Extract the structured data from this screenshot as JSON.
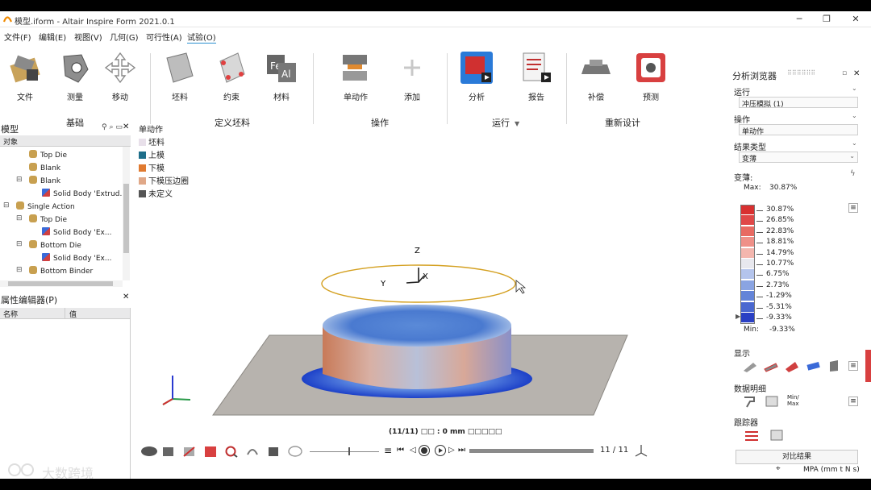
{
  "window": {
    "title": "模型.iform - Altair Inspire Form 2021.0.1",
    "minimize": "─",
    "maximize": "❐",
    "close": "✕"
  },
  "menu": [
    "文件(F)",
    "编辑(E)",
    "视图(V)",
    "几何(G)",
    "可行性(A)",
    "试验(O)"
  ],
  "ribbon": {
    "buttons": {
      "file": "文件",
      "measure": "测量",
      "move": "移动",
      "blank": "坯料",
      "constraint": "约束",
      "material": "材料",
      "single_action": "单动作",
      "add": "添加",
      "analyze": "分析",
      "report": "报告",
      "compensate": "补偿",
      "predict": "预测"
    },
    "groups": {
      "basic": "基础",
      "define_blank": "定义坯料",
      "operation": "操作",
      "run": "运行",
      "redesign": "重新设计"
    }
  },
  "model_panel": {
    "title": "模型",
    "column": "对象",
    "items": [
      {
        "label": "Top Die",
        "level": 1,
        "expand": ""
      },
      {
        "label": "Blank",
        "level": 1,
        "expand": ""
      },
      {
        "label": "Blank",
        "level": 1,
        "expand": "⊟"
      },
      {
        "label": "Solid Body 'Extrud...",
        "level": 2,
        "expand": ""
      },
      {
        "label": "Single Action",
        "level": 0,
        "expand": "⊟"
      },
      {
        "label": "Top Die",
        "level": 1,
        "expand": "⊟"
      },
      {
        "label": "Solid Body 'Ex...",
        "level": 2,
        "expand": ""
      },
      {
        "label": "Bottom Die",
        "level": 1,
        "expand": "⊟"
      },
      {
        "label": "Solid Body 'Ex...",
        "level": 2,
        "expand": ""
      },
      {
        "label": "Bottom Binder",
        "level": 1,
        "expand": "⊟"
      }
    ]
  },
  "property_panel": {
    "title": "属性编辑器(P)",
    "col_name": "名称",
    "col_value": "值"
  },
  "viewport": {
    "operation_label": "单动作",
    "legend": [
      {
        "label": "坯料",
        "color": "#e8e0ea"
      },
      {
        "label": "上模",
        "color": "#1e6e8a"
      },
      {
        "label": "下模",
        "color": "#e07a30"
      },
      {
        "label": "下模压边圈",
        "color": "#e0a888"
      },
      {
        "label": "未定义",
        "color": "#555555"
      }
    ],
    "axis_z": "Z",
    "axis_y": "Y",
    "axis_x": "X",
    "status": "(11/11) □□ : 0 mm □□□□□",
    "frame": "11 / 11"
  },
  "analysis_browser": {
    "title": "分析浏览器",
    "run_label": "运行",
    "run_value": "冲压模拟 (1)",
    "op_label": "操作",
    "op_value": "单动作",
    "result_type_label": "结果类型",
    "result_type_value": "变薄",
    "thinning_label": "变薄:",
    "max_label": "Max:",
    "max_value": "30.87%",
    "min_label": "Min:",
    "min_value": "-9.33%",
    "scale": [
      "30.87%",
      "26.85%",
      "22.83%",
      "18.81%",
      "14.79%",
      "10.77%",
      "6.75%",
      "2.73%",
      "-1.29%",
      "-5.31%",
      "-9.33%"
    ],
    "display_label": "显示",
    "data_detail_label": "数据明细",
    "minmax_label": "Min/\nMax",
    "tracker_label": "跟踪器",
    "compare_button": "对比结果"
  },
  "statusbar": {
    "units": "MPA (mm t N s)",
    "watermark": "大数跨境"
  }
}
